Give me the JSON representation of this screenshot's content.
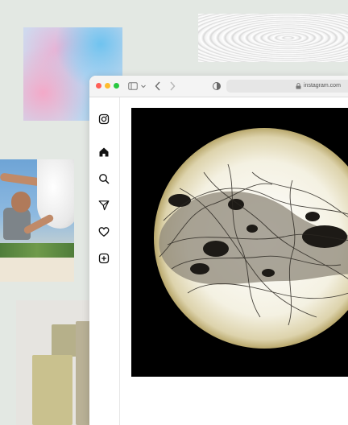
{
  "browser": {
    "address": "instagram.com"
  },
  "icons": {
    "sidebar_toggle": "sidebar-icon",
    "back": "chevron-left-icon",
    "forward": "chevron-right-icon",
    "privacy": "shield-icon",
    "lock": "lock-icon"
  },
  "nav": {
    "items": [
      {
        "icon": "instagram-logo-icon"
      },
      {
        "icon": "home-icon"
      },
      {
        "icon": "search-icon"
      },
      {
        "icon": "direct-message-icon"
      },
      {
        "icon": "heart-icon"
      },
      {
        "icon": "create-post-icon"
      }
    ]
  },
  "colors": {
    "background": "#e3e8e3",
    "traffic_close": "#ff5f57",
    "traffic_min": "#febc2e",
    "traffic_max": "#28c840"
  }
}
